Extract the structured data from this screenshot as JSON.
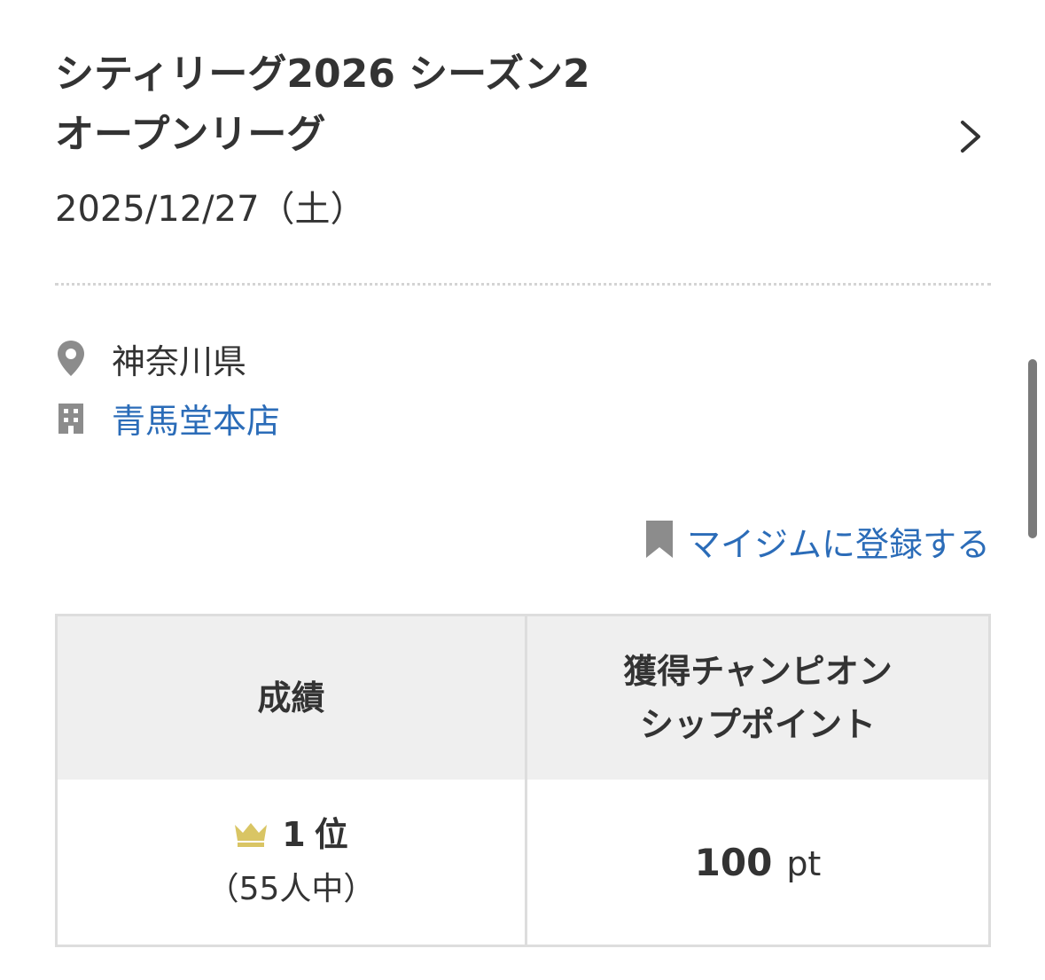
{
  "event": {
    "title_line1": "シティリーグ2026 シーズン2",
    "title_line2": "オープンリーグ",
    "date": "2025/12/27（土）"
  },
  "location": {
    "prefecture": "神奈川県",
    "store": "青馬堂本店",
    "prefecture_icon": "map-pin-icon",
    "store_icon": "building-icon"
  },
  "mygym": {
    "label": "マイジムに登録する",
    "icon": "bookmark-icon"
  },
  "results": {
    "header_rank": "成績",
    "header_points_line1": "獲得チャンピオン",
    "header_points_line2": "シップポイント",
    "rank_number": "1",
    "rank_suffix": "位",
    "participants": "（55人中）",
    "points_value": "100",
    "points_unit": "pt"
  },
  "colors": {
    "text": "#333333",
    "link": "#2b6cb8",
    "crown": "#d9c564",
    "icon_gray": "#8c8c8c",
    "table_header_bg": "#efefef",
    "border": "#dddddd"
  }
}
